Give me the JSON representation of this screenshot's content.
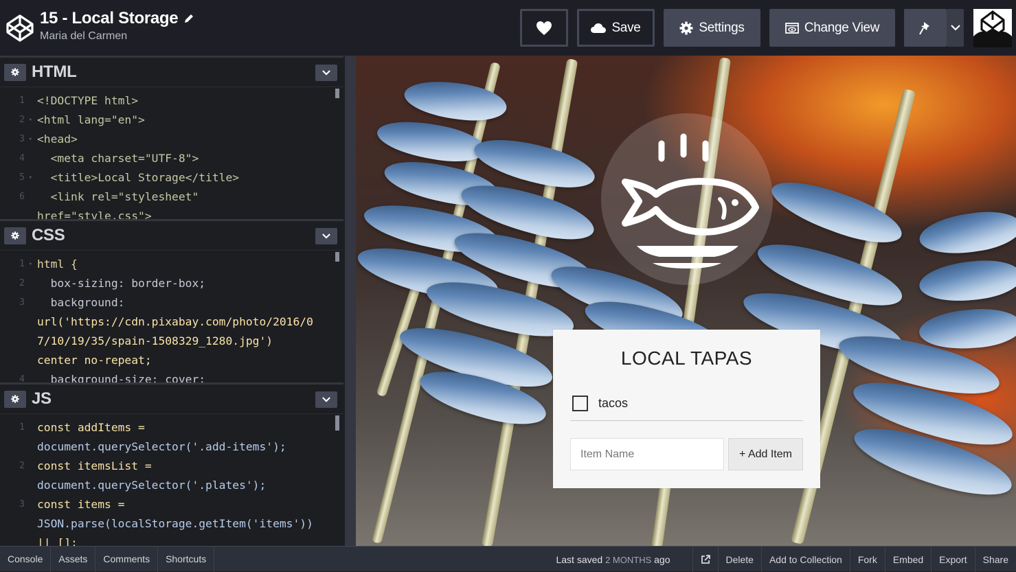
{
  "header": {
    "title": "15 - Local Storage",
    "author": "Maria del Carmen",
    "buttons": {
      "save": "Save",
      "settings": "Settings",
      "change_view": "Change View"
    },
    "icons": [
      "codepen-logo-icon",
      "pencil-icon",
      "heart-icon",
      "cloud-icon",
      "gear-icon",
      "eye-window-icon",
      "pin-icon",
      "chevron-down-icon",
      "avatar"
    ]
  },
  "editors": {
    "html": {
      "name": "HTML",
      "lines": [
        {
          "n": "1",
          "text": "<!DOCTYPE html>"
        },
        {
          "n": "2",
          "text": "<html lang=\"en\">"
        },
        {
          "n": "3",
          "text": "<head>"
        },
        {
          "n": "4",
          "text": "  <meta charset=\"UTF-8\">"
        },
        {
          "n": "5",
          "text": "  <title>Local Storage</title>"
        },
        {
          "n": "6",
          "text": "  <link rel=\"stylesheet\""
        },
        {
          "n": "",
          "text": "href=\"style.css\">"
        }
      ]
    },
    "css": {
      "name": "CSS",
      "lines": [
        {
          "n": "1",
          "text": "html {"
        },
        {
          "n": "2",
          "text": "  box-sizing: border-box;"
        },
        {
          "n": "3",
          "text": "  background:"
        },
        {
          "n": "",
          "text": "url('https://cdn.pixabay.com/photo/2016/0"
        },
        {
          "n": "",
          "text": "7/10/19/35/spain-1508329_1280.jpg')"
        },
        {
          "n": "",
          "text": "center no-repeat;"
        },
        {
          "n": "4",
          "text": "  background-size: cover;"
        }
      ]
    },
    "js": {
      "name": "JS",
      "lines": [
        {
          "n": "1",
          "text": "const addItems ="
        },
        {
          "n": "",
          "text": "document.querySelector('.add-items');"
        },
        {
          "n": "2",
          "text": "const itemsList ="
        },
        {
          "n": "",
          "text": "document.querySelector('.plates');"
        },
        {
          "n": "3",
          "text": "const items ="
        },
        {
          "n": "",
          "text": "JSON.parse(localStorage.getItem('items'))"
        },
        {
          "n": "",
          "text": "|| [];"
        }
      ]
    }
  },
  "preview": {
    "heading": "LOCAL TAPAS",
    "items": [
      {
        "label": "tacos",
        "done": false
      }
    ],
    "input_placeholder": "Item Name",
    "add_button": "+ Add Item"
  },
  "footer": {
    "left": [
      "Console",
      "Assets",
      "Comments",
      "Shortcuts"
    ],
    "saved_prefix": "Last saved",
    "saved_when": "2 MONTHS",
    "saved_suffix": "ago",
    "right": [
      "Delete",
      "Add to Collection",
      "Fork",
      "Embed",
      "Export",
      "Share"
    ]
  }
}
